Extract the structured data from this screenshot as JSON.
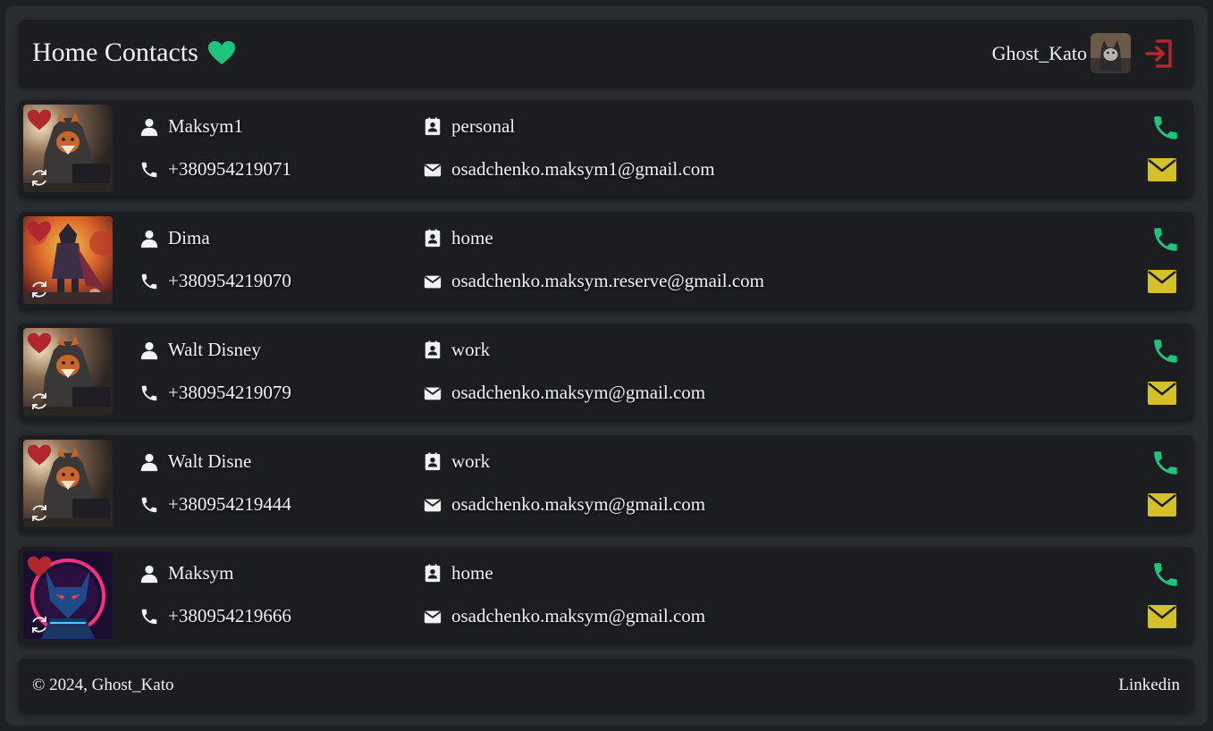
{
  "header": {
    "title": "Home Contacts",
    "username": "Ghost_Kato"
  },
  "colors": {
    "favorite_header": "#1ec47c",
    "favorite_card": "#b0272d",
    "call": "#1ec47c",
    "mail": "#d4c12a",
    "logout": "#b0272d"
  },
  "contacts": [
    {
      "name": "Maksym1",
      "phone": "+380954219071",
      "category": "personal",
      "email": "osadchenko.maksym1@gmail.com",
      "avatar": "fox-hooded"
    },
    {
      "name": "Dima",
      "phone": "+380954219070",
      "category": "home",
      "email": "osadchenko.maksym.reserve@gmail.com",
      "avatar": "samurai"
    },
    {
      "name": "Walt Disney",
      "phone": "+380954219079",
      "category": "work",
      "email": "osadchenko.maksym@gmail.com",
      "avatar": "fox-hooded"
    },
    {
      "name": "Walt Disne",
      "phone": "+380954219444",
      "category": "work",
      "email": "osadchenko.maksym@gmail.com",
      "avatar": "fox-hooded"
    },
    {
      "name": "Maksym",
      "phone": "+380954219666",
      "category": "home",
      "email": "osadchenko.maksym@gmail.com",
      "avatar": "neon-wolf"
    }
  ],
  "footer": {
    "copyright": "© 2024, Ghost_Kato",
    "link": "Linkedin"
  }
}
